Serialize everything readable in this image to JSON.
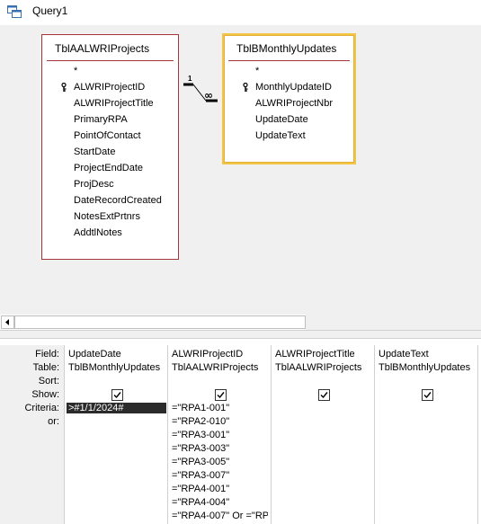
{
  "window": {
    "title": "Query1"
  },
  "tables": [
    {
      "name": "TblAALWRIProjects",
      "fields": [
        {
          "label": "*",
          "key": false
        },
        {
          "label": "ALWRIProjectID",
          "key": true
        },
        {
          "label": "ALWRIProjectTitle",
          "key": false
        },
        {
          "label": "PrimaryRPA",
          "key": false
        },
        {
          "label": "PointOfContact",
          "key": false
        },
        {
          "label": "StartDate",
          "key": false
        },
        {
          "label": "ProjectEndDate",
          "key": false
        },
        {
          "label": "ProjDesc",
          "key": false
        },
        {
          "label": "DateRecordCreated",
          "key": false
        },
        {
          "label": "NotesExtPrtnrs",
          "key": false
        },
        {
          "label": "AddtlNotes",
          "key": false
        }
      ]
    },
    {
      "name": "TblBMonthlyUpdates",
      "fields": [
        {
          "label": "*",
          "key": false
        },
        {
          "label": "MonthlyUpdateID",
          "key": true
        },
        {
          "label": "ALWRIProjectNbr",
          "key": false
        },
        {
          "label": "UpdateDate",
          "key": false
        },
        {
          "label": "UpdateText",
          "key": false
        }
      ]
    }
  ],
  "relationship": {
    "one": "1",
    "many": "∞"
  },
  "grid": {
    "row_labels": {
      "field": "Field:",
      "table": "Table:",
      "sort": "Sort:",
      "show": "Show:",
      "criteria": "Criteria:",
      "or": "or:"
    },
    "columns": [
      {
        "field": "UpdateDate",
        "table": "TblBMonthlyUpdates",
        "show": true,
        "criteria": [
          ">#1/1/2024#"
        ]
      },
      {
        "field": "ALWRIProjectID",
        "table": "TblAALWRIProjects",
        "show": true,
        "criteria": [
          "=\"RPA1-001\"",
          "=\"RPA2-010\"",
          "=\"RPA3-001\"",
          "=\"RPA3-003\"",
          "=\"RPA3-005\"",
          "=\"RPA3-007\"",
          "=\"RPA4-001\"",
          "=\"RPA4-004\"",
          "=\"RPA4-007\" Or =\"RP/"
        ]
      },
      {
        "field": "ALWRIProjectTitle",
        "table": "TblAALWRIProjects",
        "show": true,
        "criteria": []
      },
      {
        "field": "UpdateText",
        "table": "TblBMonthlyUpdates",
        "show": true,
        "criteria": []
      }
    ]
  }
}
